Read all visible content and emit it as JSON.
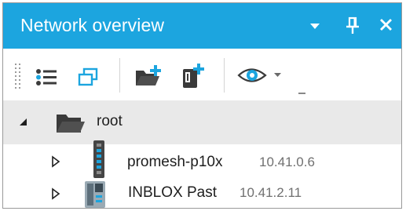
{
  "panel": {
    "title": "Network overview",
    "colors": {
      "title_bg": "#1ca5df",
      "selection_bg": "#e9e9e9"
    }
  },
  "title_buttons": [
    {
      "name": "dropdown-arrow-icon"
    },
    {
      "name": "pin-icon"
    },
    {
      "name": "close-icon"
    }
  ],
  "toolbar": {
    "buttons": [
      {
        "name": "list-view-icon"
      },
      {
        "name": "windows-icon"
      },
      {
        "name": "add-folder-icon"
      },
      {
        "name": "add-device-icon"
      },
      {
        "name": "view-eye-icon"
      }
    ]
  },
  "tree": {
    "root": {
      "label": "root",
      "expanded": true
    },
    "children": [
      {
        "label": "promesh-p10x",
        "ip": "10.41.0.6",
        "icon": "switch-device-icon",
        "expanded": false
      },
      {
        "label": "INBLOX Past",
        "ip": "10.41.2.11",
        "icon": "inblox-device-icon",
        "expanded": false
      }
    ]
  }
}
